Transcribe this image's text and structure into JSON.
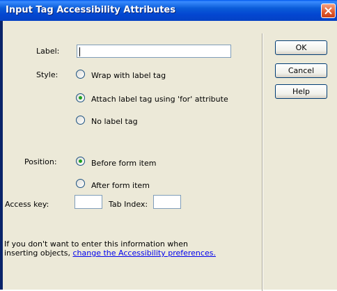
{
  "window": {
    "title": "Input Tag Accessibility Attributes"
  },
  "form": {
    "label_caption": "Label:",
    "label_value": "",
    "style_caption": "Style:",
    "style_options": [
      {
        "label": "Wrap with label tag",
        "checked": false
      },
      {
        "label": "Attach label tag using 'for' attribute",
        "checked": true
      },
      {
        "label": "No label tag",
        "checked": false
      }
    ],
    "position_caption": "Position:",
    "position_options": [
      {
        "label": "Before form item",
        "checked": true
      },
      {
        "label": "After form item",
        "checked": false
      }
    ],
    "access_key_caption": "Access key:",
    "access_key_value": "",
    "tab_index_caption": "Tab Index:",
    "tab_index_value": ""
  },
  "buttons": {
    "ok": "OK",
    "cancel": "Cancel",
    "help": "Help"
  },
  "footer": {
    "line1": "If you don't want to enter this information when",
    "line2_prefix": "inserting objects,",
    "link_text": "change the Accessibility preferences."
  },
  "colors": {
    "titlebar": "#0a5bd8",
    "dialog_bg": "#ece9d8",
    "radio_dot": "#21a121",
    "link": "#0000ee",
    "close_button": "#e15a2c"
  },
  "icons": {
    "close": "close-x-icon"
  }
}
